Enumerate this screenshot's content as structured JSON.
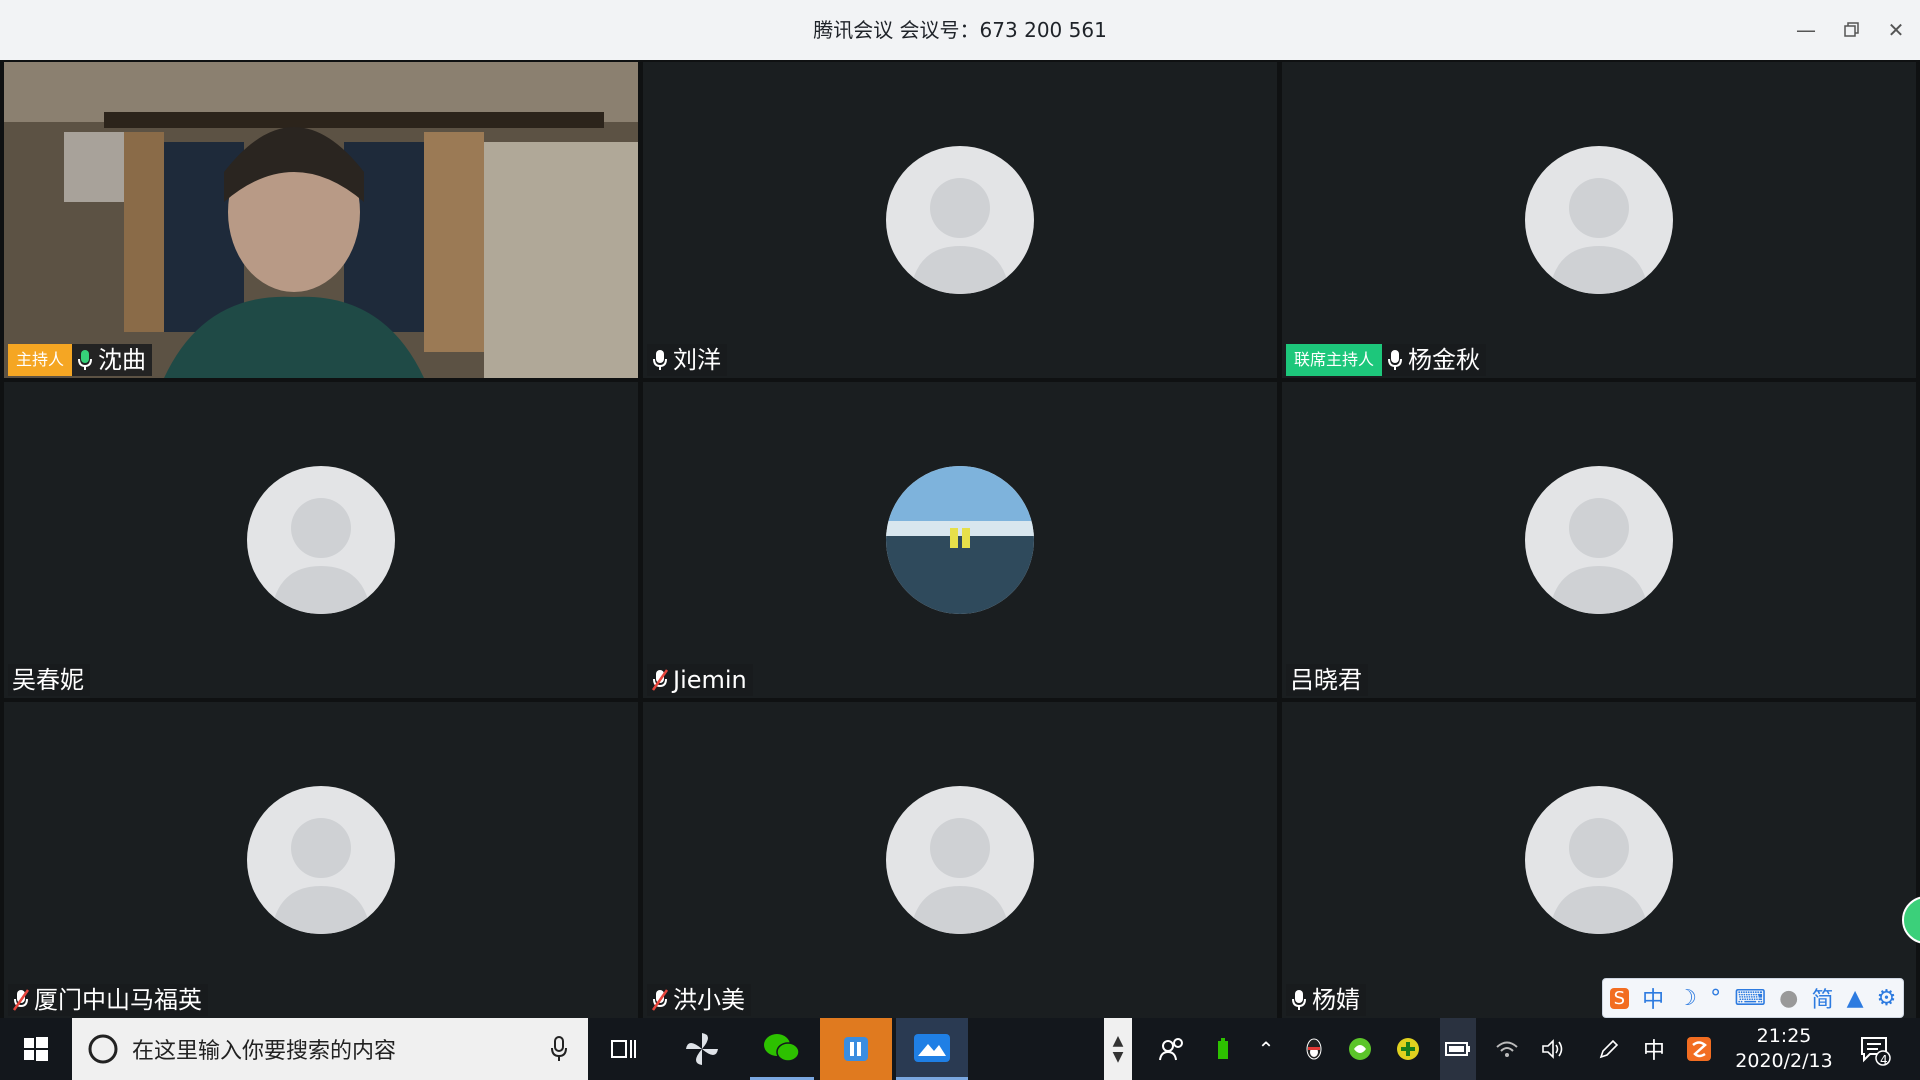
{
  "window": {
    "title": "腾讯会议 会议号：673 200 561",
    "minimize_icon": "minimize-icon",
    "restore_icon": "restore-icon",
    "close_icon": "close-icon"
  },
  "participants": [
    {
      "name": "沈曲",
      "badge": "主持人",
      "badge_type": "host",
      "mic": "on",
      "video": true
    },
    {
      "name": "刘洋",
      "badge": "",
      "mic": "on",
      "video": false
    },
    {
      "name": "杨金秋",
      "badge": "联席主持人",
      "badge_type": "cohost",
      "mic": "on",
      "video": false
    },
    {
      "name": "吴春妮",
      "badge": "",
      "mic": "none",
      "video": false
    },
    {
      "name": "Jiemin",
      "badge": "",
      "mic": "muted",
      "video": false,
      "photo_avatar": true
    },
    {
      "name": "吕晓君",
      "badge": "",
      "mic": "none",
      "video": false
    },
    {
      "name": "厦门中山马福英",
      "badge": "",
      "mic": "muted",
      "video": false
    },
    {
      "name": "洪小美",
      "badge": "",
      "mic": "muted",
      "video": false
    },
    {
      "name": "杨婧",
      "badge": "",
      "mic": "on",
      "video": false
    }
  ],
  "taskbar": {
    "search_placeholder": "在这里输入你要搜索的内容",
    "time": "21:25",
    "date": "2020/2/13",
    "notification_count": "4",
    "ime_label": "中"
  },
  "ime_toolbar": {
    "items": [
      "中",
      "简"
    ]
  },
  "colors": {
    "host_badge": "#f5a623",
    "cohost_badge": "#1dc77b",
    "tile_bg": "#1a1e20"
  }
}
